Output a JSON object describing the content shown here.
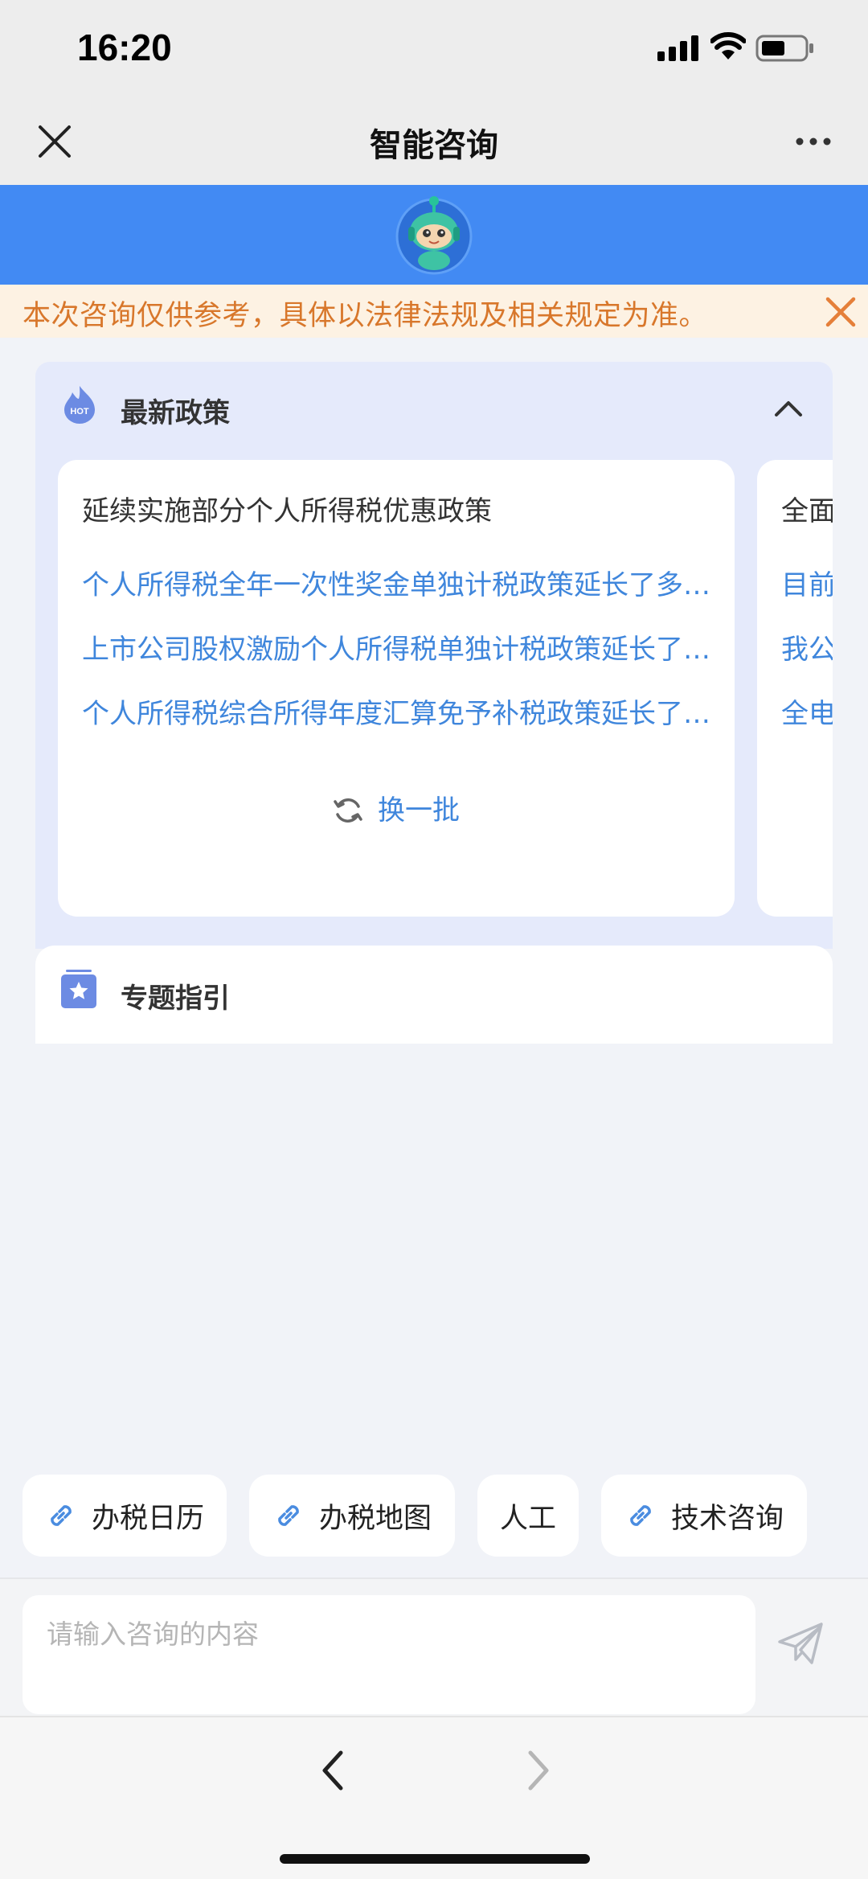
{
  "status_bar": {
    "time": "16:20"
  },
  "nav": {
    "title": "智能咨询",
    "close_icon": "close-icon",
    "more_icon": "more-icon"
  },
  "notice": {
    "text": "本次咨询仅供参考，具体以法律法规及相关规定为准。"
  },
  "policy": {
    "title": "最新政策",
    "hot_badge": "HOT",
    "card": {
      "title": "延续实施部分个人所得税优惠政策",
      "links": [
        "个人所得税全年一次性奖金单独计税政策延长了多久？",
        "上市公司股权激励个人所得税单独计税政策延长了多久？",
        "个人所得税综合所得年度汇算免予补税政策延长了多久？"
      ],
      "refresh_label": "换一批"
    },
    "next_card": {
      "title": "全面",
      "links": [
        "目前",
        "我公",
        "全电"
      ]
    }
  },
  "topic": {
    "title": "专题指引"
  },
  "quick_buttons": [
    {
      "label": "办税日历",
      "icon": "link-icon"
    },
    {
      "label": "办税地图",
      "icon": "link-icon"
    },
    {
      "label": "人工",
      "icon": ""
    },
    {
      "label": "技术咨询",
      "icon": "link-icon"
    }
  ],
  "input": {
    "placeholder": "请输入咨询的内容"
  },
  "colors": {
    "brand_blue": "#428af3",
    "link_blue": "#3f86dc",
    "notice_orange": "#d8772b",
    "notice_bg": "#fdf2e3"
  }
}
